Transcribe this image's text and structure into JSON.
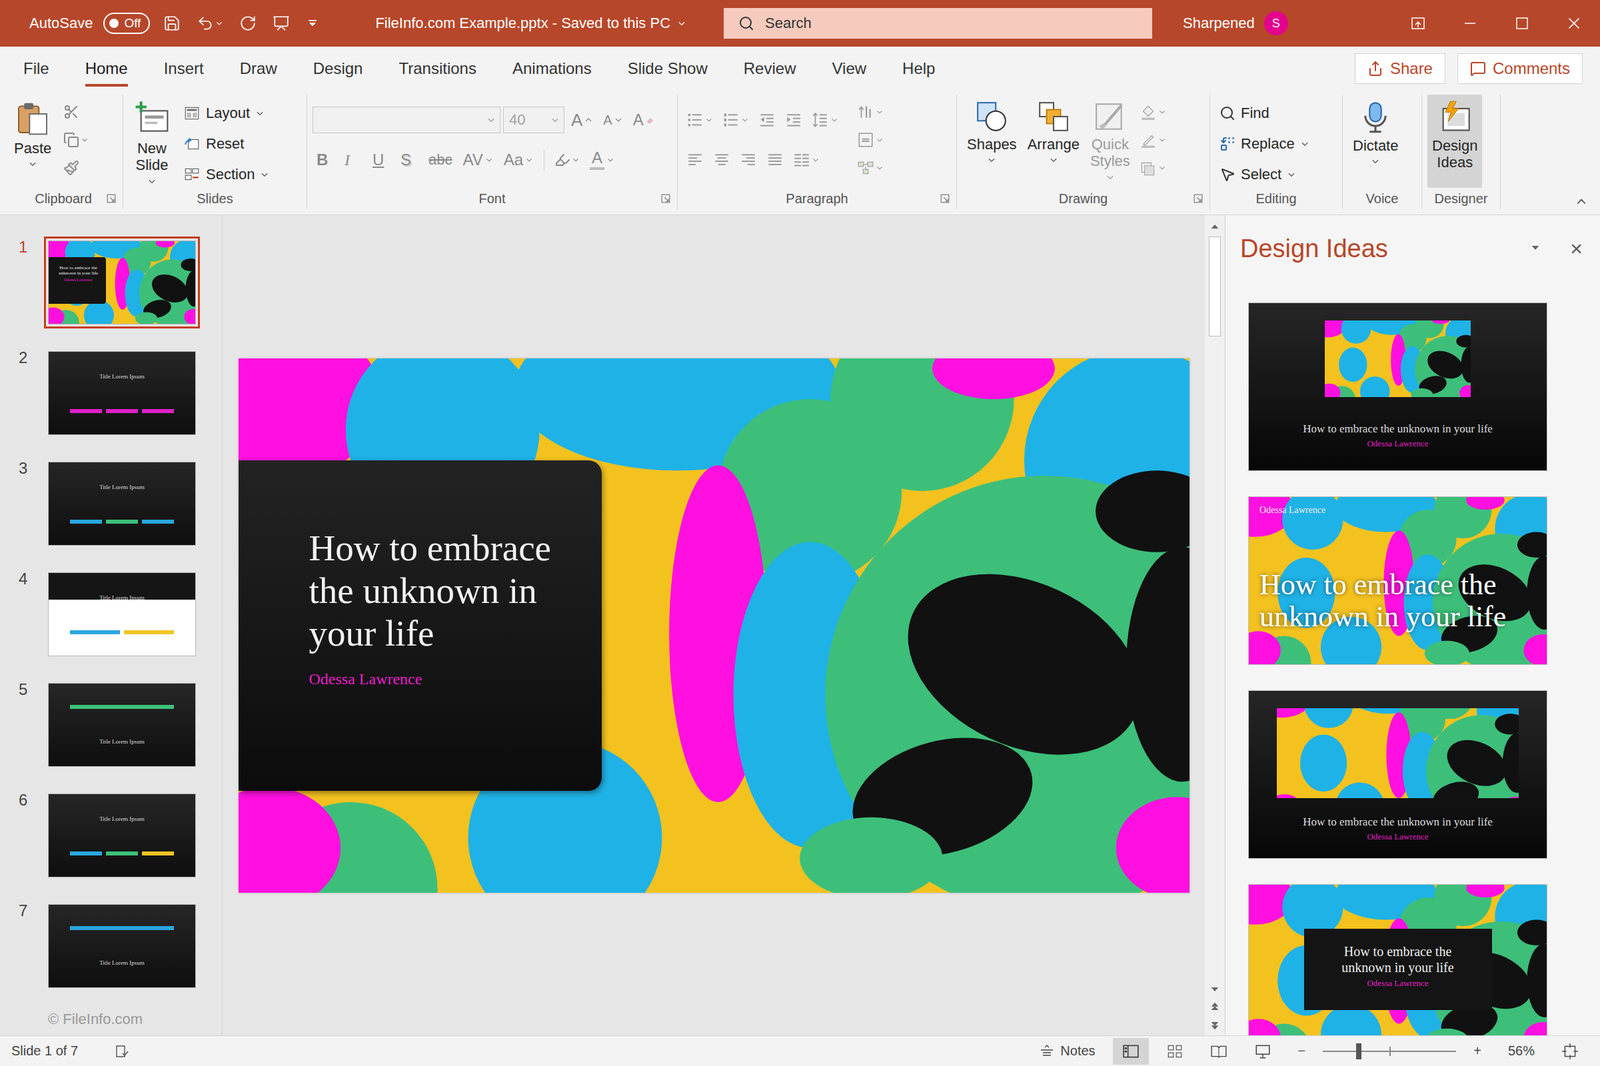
{
  "window": {
    "title": "FileInfo.com Example.pptx - Saved to this PC",
    "autosave": {
      "label": "AutoSave",
      "state": "Off",
      "on": false
    },
    "search": {
      "placeholder": "Search"
    },
    "user": {
      "name": "Sharpened",
      "initial": "S"
    }
  },
  "tabs": [
    {
      "label": "File",
      "selected": false
    },
    {
      "label": "Home",
      "selected": true
    },
    {
      "label": "Insert",
      "selected": false
    },
    {
      "label": "Draw",
      "selected": false
    },
    {
      "label": "Design",
      "selected": false
    },
    {
      "label": "Transitions",
      "selected": false
    },
    {
      "label": "Animations",
      "selected": false
    },
    {
      "label": "Slide Show",
      "selected": false
    },
    {
      "label": "Review",
      "selected": false
    },
    {
      "label": "View",
      "selected": false
    },
    {
      "label": "Help",
      "selected": false
    }
  ],
  "tab_actions": {
    "share": "Share",
    "comments": "Comments"
  },
  "ribbon": {
    "clipboard": {
      "label": "Clipboard",
      "paste": "Paste"
    },
    "slides": {
      "label": "Slides",
      "new_slide": "New Slide",
      "layout": "Layout",
      "reset": "Reset",
      "section": "Section"
    },
    "font": {
      "label": "Font",
      "disabled": true,
      "font_size": "40",
      "grow": "A",
      "shrink": "A",
      "clear": "A",
      "font_color": "A",
      "styles": [
        {
          "text": "B",
          "kind": "bold",
          "menu": false
        },
        {
          "text": "I",
          "kind": "italic",
          "menu": false
        },
        {
          "text": "U",
          "kind": "underline",
          "menu": false
        },
        {
          "text": "S",
          "kind": "shadow",
          "menu": false
        },
        {
          "text": "abc",
          "kind": "strike",
          "menu": false
        },
        {
          "text": "AV",
          "kind": "spacing",
          "menu": true
        },
        {
          "text": "Aa",
          "kind": "case",
          "menu": true
        }
      ]
    },
    "paragraph": {
      "label": "Paragraph",
      "disabled": true
    },
    "drawing": {
      "label": "Drawing",
      "shapes": "Shapes",
      "arrange": "Arrange",
      "quick_styles": "Quick Styles",
      "quick_styles_disabled": true
    },
    "editing": {
      "label": "Editing",
      "find": "Find",
      "replace": "Replace",
      "select": "Select"
    },
    "voice": {
      "label": "Voice",
      "dictate": "Dictate"
    },
    "designer": {
      "label": "Designer",
      "design_ideas": "Design Ideas",
      "selected": true
    }
  },
  "thumbnails": [
    {
      "number": "1",
      "selected": true,
      "kind": "title",
      "title": "How to embrace the unknown in your life",
      "author": "Odessa Lawrence"
    },
    {
      "number": "2",
      "selected": false,
      "kind": "diagram",
      "title": "Title Lorem Ipsum",
      "title_position": "top",
      "light": false,
      "accents": [
        "#e020c8",
        "#e020c8",
        "#e020c8"
      ]
    },
    {
      "number": "3",
      "selected": false,
      "kind": "diagram",
      "title": "Title Lorem Ipsum",
      "title_position": "top",
      "light": false,
      "accents": [
        "#2aa7e0",
        "#3cc07a",
        "#2aa7e0"
      ]
    },
    {
      "number": "4",
      "selected": false,
      "kind": "diagram",
      "title": "Title Lorem Ipsum",
      "title_position": "top",
      "light": true,
      "accents": [
        "#2aa7e0",
        "#f2c523"
      ]
    },
    {
      "number": "5",
      "selected": false,
      "kind": "diagram",
      "title": "Title Lorem Ipsum",
      "title_position": "bottom",
      "light": false,
      "accents": [
        "#3cc07a"
      ]
    },
    {
      "number": "6",
      "selected": false,
      "kind": "diagram",
      "title": "Title Lorem Ipsum",
      "title_position": "top",
      "light": false,
      "accents": [
        "#2aa7e0",
        "#3cc07a",
        "#f2c523"
      ]
    },
    {
      "number": "7",
      "selected": false,
      "kind": "diagram",
      "title": "Title Lorem Ipsum",
      "title_position": "bottom",
      "light": false,
      "accents": [
        "#2aa7e0"
      ]
    }
  ],
  "watermark": "© FileInfo.com",
  "slide": {
    "title": "How to embrace the unknown in your life",
    "author": "Odessa Lawrence"
  },
  "design_pane": {
    "title": "Design Ideas",
    "close": "×",
    "ideas": [
      {
        "kind": "dark-inset",
        "title": "How to embrace the unknown in your life",
        "author": "Odessa Lawrence"
      },
      {
        "kind": "full-image",
        "title": "How to embrace the unknown in your life",
        "author": "Odessa Lawrence"
      },
      {
        "kind": "dark-wide",
        "title": "How to embrace the unknown in your life",
        "author": "Odessa Lawrence"
      },
      {
        "kind": "boxed",
        "title": "How to embrace the unknown in your life",
        "author": "Odessa Lawrence"
      }
    ]
  },
  "status_bar": {
    "slide_info": "Slide 1 of 7",
    "notes": "Notes",
    "views": [
      {
        "kind": "normal",
        "selected": true
      },
      {
        "kind": "sorter",
        "selected": false
      },
      {
        "kind": "reading",
        "selected": false
      },
      {
        "kind": "slideshow",
        "selected": false
      }
    ],
    "zoom_out": "−",
    "zoom_in": "+",
    "zoom": "56%",
    "zoom_level": 0.27
  }
}
